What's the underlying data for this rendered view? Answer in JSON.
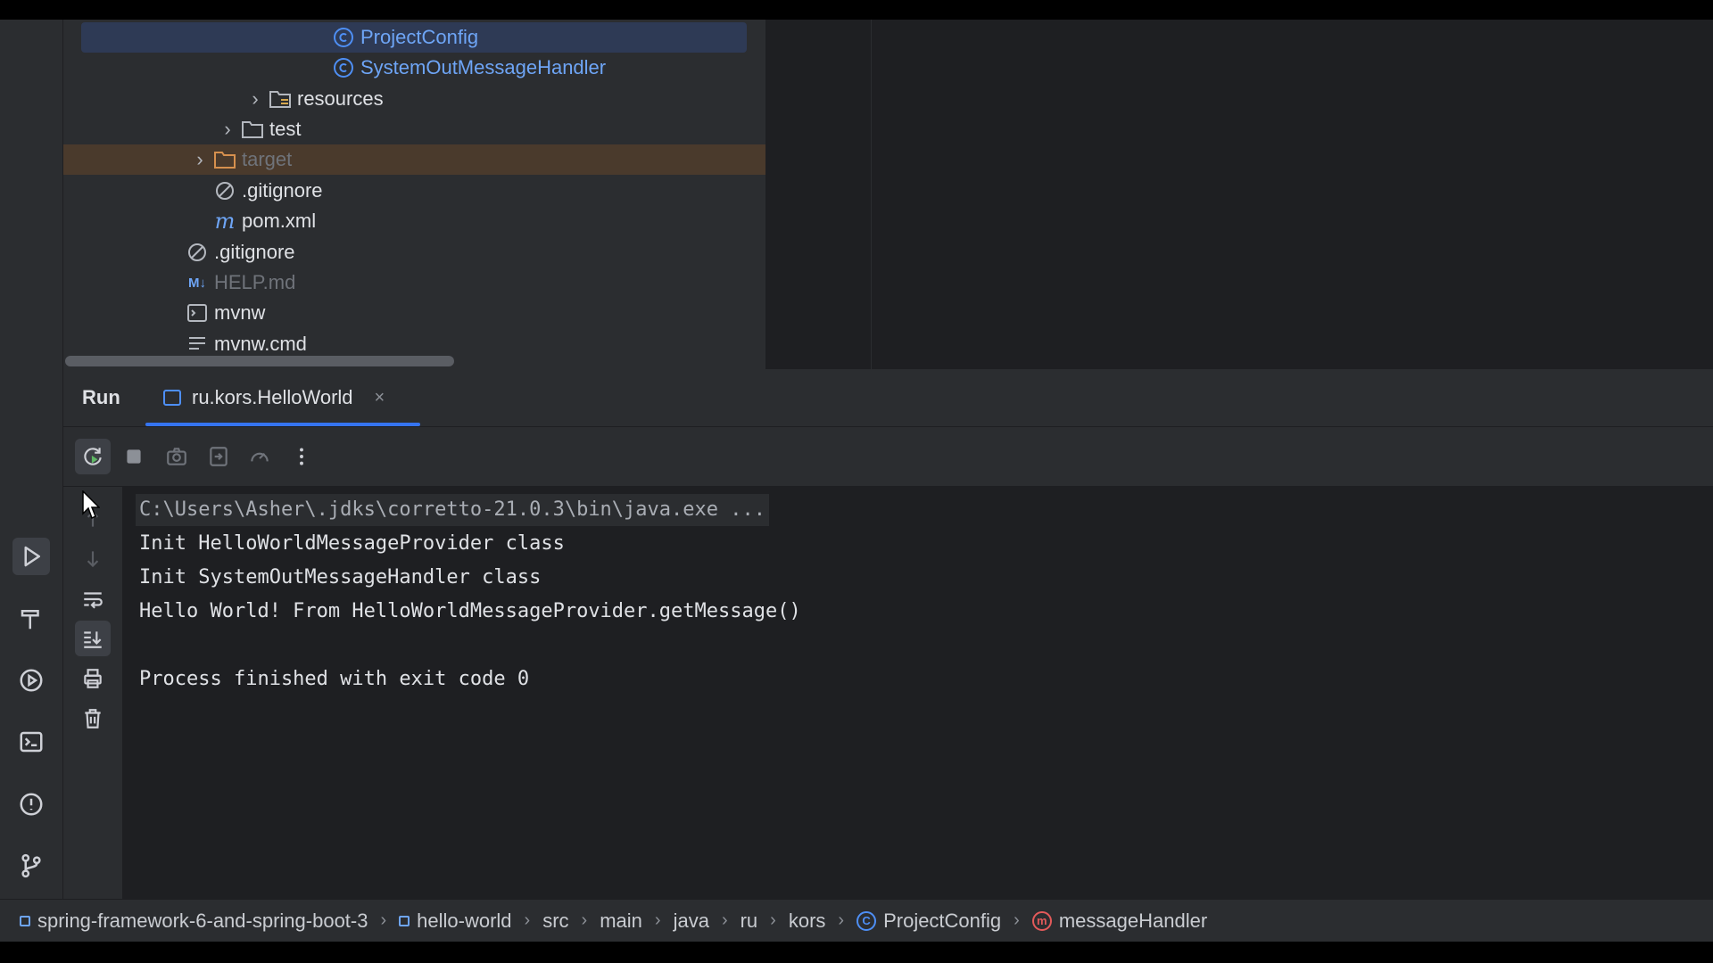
{
  "project_tree": {
    "rows": [
      {
        "label": "ProjectConfig",
        "icon": "class-icon"
      },
      {
        "label": "SystemOutMessageHandler",
        "icon": "class-icon"
      },
      {
        "label": "resources",
        "icon": "resources-folder-icon"
      },
      {
        "label": "test",
        "icon": "folder-icon"
      },
      {
        "label": "target",
        "icon": "excluded-folder-icon"
      },
      {
        "label": ".gitignore",
        "icon": "ignore-icon"
      },
      {
        "label": "pom.xml",
        "icon": "maven-icon"
      },
      {
        "label": ".gitignore",
        "icon": "ignore-icon"
      },
      {
        "label": "HELP.md",
        "icon": "markdown-icon",
        "icon_text": "M↓"
      },
      {
        "label": "mvnw",
        "icon": "terminal-file-icon"
      },
      {
        "label": "mvnw.cmd",
        "icon": "text-file-icon"
      }
    ]
  },
  "run_window": {
    "title": "Run",
    "tab": {
      "label": "ru.kors.HelloWorld",
      "close": "×"
    }
  },
  "console": {
    "lines": [
      "C:\\Users\\Asher\\.jdks\\corretto-21.0.3\\bin\\java.exe ...",
      "Init HelloWorldMessageProvider class",
      "Init SystemOutMessageHandler class",
      "Hello World! From HelloWorldMessageProvider.getMessage()",
      "",
      "Process finished with exit code 0"
    ]
  },
  "breadcrumbs": {
    "items": [
      {
        "label": "spring-framework-6-and-spring-boot-3",
        "icon": "module-icon"
      },
      {
        "label": "hello-world",
        "icon": "module-icon"
      },
      {
        "label": "src"
      },
      {
        "label": "main"
      },
      {
        "label": "java"
      },
      {
        "label": "ru"
      },
      {
        "label": "kors"
      },
      {
        "label": "ProjectConfig",
        "icon": "class-icon",
        "icon_text": "C"
      },
      {
        "label": "messageHandler",
        "icon": "method-icon",
        "icon_text": "m"
      }
    ],
    "separator": "›"
  },
  "colors": {
    "accent": "#3574f0",
    "class_blue": "#6ea5f6",
    "excluded_bg": "#4a3a2c",
    "method_red": "#e35a5a"
  }
}
